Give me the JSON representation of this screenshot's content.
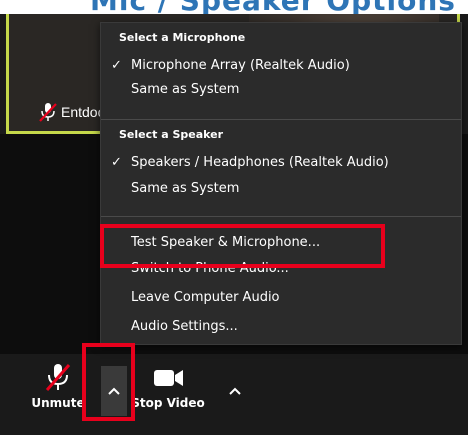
{
  "header_banner": {
    "text": "Mic / Speaker Options"
  },
  "video_tile": {
    "participant_name": "Entdoc Cta"
  },
  "audio_menu": {
    "microphone_header": "Select a Microphone",
    "microphone_items": [
      {
        "label": "Microphone Array (Realtek Audio)",
        "checked": true
      },
      {
        "label": "Same as System",
        "checked": false
      }
    ],
    "speaker_header": "Select a Speaker",
    "speaker_items": [
      {
        "label": "Speakers / Headphones (Realtek Audio)",
        "checked": true
      },
      {
        "label": "Same as System",
        "checked": false
      }
    ],
    "actions": [
      {
        "label": "Test Speaker & Microphone..."
      },
      {
        "label": "Switch to Phone Audio..."
      },
      {
        "label": "Leave Computer Audio"
      },
      {
        "label": "Audio Settings..."
      }
    ],
    "check_glyph": "✓"
  },
  "toolbar": {
    "unmute_label": "Unmute",
    "stop_video_label": "Stop Video"
  },
  "colors": {
    "highlight": "#e8001c",
    "tile_border": "#c5d84a",
    "banner": "#2e75b6"
  },
  "icons": [
    "muted-mic-icon",
    "caret-up-icon",
    "video-camera-icon"
  ]
}
